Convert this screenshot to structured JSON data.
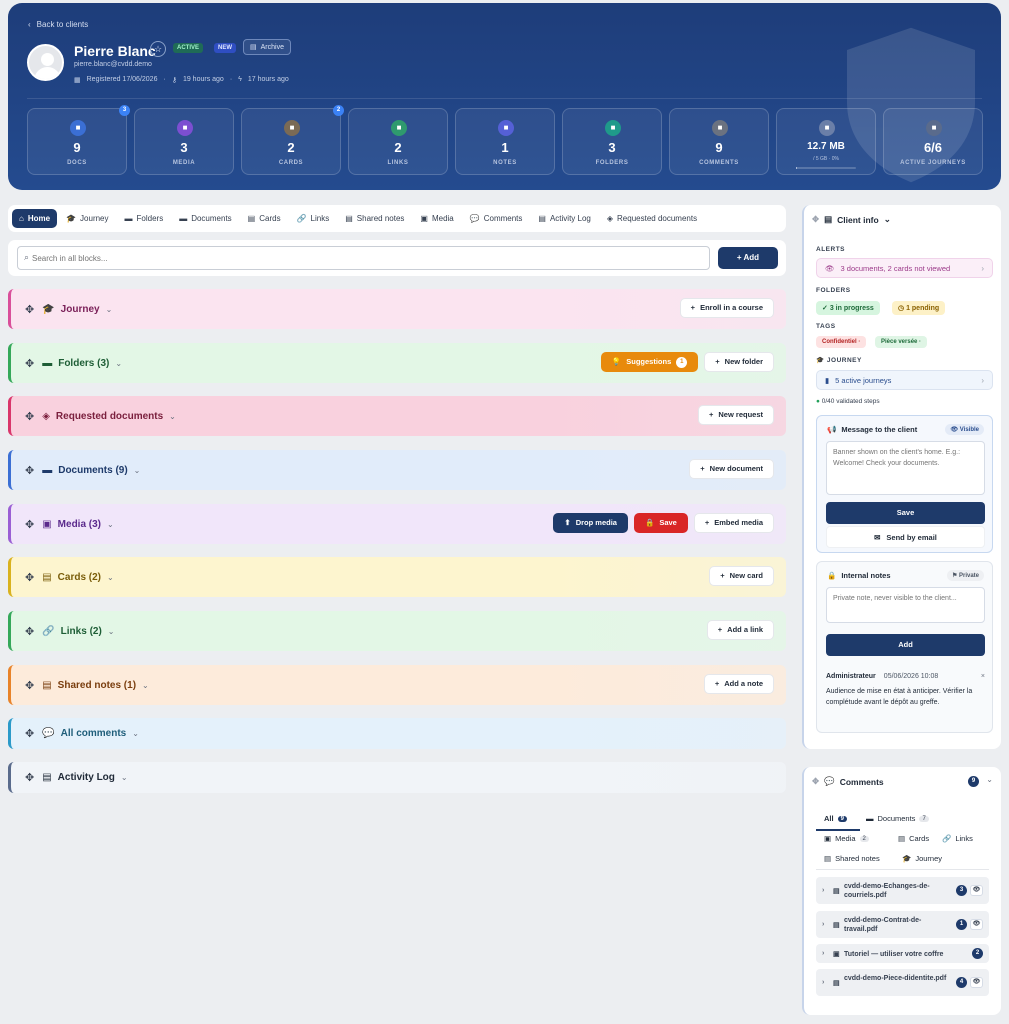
{
  "header": {
    "back_label": "Back to clients",
    "name": "Pierre Blanc",
    "badge_active": "ACTIVE",
    "badge_new": "NEW",
    "archive_label": "Archive",
    "email": "pierre.blanc@cvdd.demo",
    "registered": "Registered 17/06/2026",
    "last_login": "19 hours ago",
    "last_activity": "17 hours ago"
  },
  "stats": [
    {
      "value": "9",
      "label": "DOCS",
      "badge": "3",
      "color": "#3b6fd4",
      "icon": "doc-icon"
    },
    {
      "value": "3",
      "label": "MEDIA",
      "badge": "",
      "color": "#7c4fd1",
      "icon": "media-icon"
    },
    {
      "value": "2",
      "label": "CARDS",
      "badge": "2",
      "color": "#7a6a55",
      "icon": "card-icon"
    },
    {
      "value": "2",
      "label": "LINKS",
      "badge": "",
      "color": "#2f9a6e",
      "icon": "link-icon"
    },
    {
      "value": "1",
      "label": "NOTES",
      "badge": "",
      "color": "#5560d6",
      "icon": "note-icon"
    },
    {
      "value": "3",
      "label": "FOLDERS",
      "badge": "",
      "color": "#1f9a8a",
      "icon": "folder-icon"
    },
    {
      "value": "9",
      "label": "COMMENTS",
      "badge": "",
      "color": "#6b7280",
      "icon": "comment-icon"
    },
    {
      "value": "12.7 MB",
      "label": "",
      "sub": "/ 5 GB · 0%",
      "progress": 0.02,
      "color": "#6b7fa8",
      "icon": "cloud-icon"
    },
    {
      "value": "6/6",
      "label": "ACTIVE JOURNEYS",
      "badge": "",
      "color": "#5a6b8c",
      "icon": "graduation-icon"
    }
  ],
  "tabs": [
    "Home",
    "Journey",
    "Folders",
    "Documents",
    "Cards",
    "Links",
    "Shared notes",
    "Media",
    "Comments",
    "Activity Log",
    "Requested documents"
  ],
  "search": {
    "placeholder": "Search in all blocks...",
    "add_label": "Add"
  },
  "blocks": [
    {
      "title": "Journey",
      "actions": [
        "Enroll in a course"
      ]
    },
    {
      "title": "Folders (3)",
      "suggestions": "Suggestions",
      "suggestions_count": "1",
      "actions": [
        "New folder"
      ]
    },
    {
      "title": "Requested documents",
      "actions": [
        "New request"
      ]
    },
    {
      "title": "Documents (9)",
      "actions": [
        "New document"
      ]
    },
    {
      "title": "Media (3)",
      "drop": "Drop media",
      "save": "Save",
      "actions": [
        "Embed media"
      ]
    },
    {
      "title": "Cards (2)",
      "actions": [
        "New card"
      ]
    },
    {
      "title": "Links (2)",
      "actions": [
        "Add a link"
      ]
    },
    {
      "title": "Shared notes (1)",
      "actions": [
        "Add a note"
      ]
    },
    {
      "title": "All comments",
      "actions": []
    },
    {
      "title": "Activity Log",
      "actions": []
    }
  ],
  "client_info": {
    "title": "Client info",
    "alerts_label": "ALERTS",
    "alert_text": "3 documents, 2 cards not viewed",
    "folders_label": "FOLDERS",
    "in_progress": "3 in progress",
    "pending": "1 pending",
    "tags_label": "TAGS",
    "tag1": "Confidentiel",
    "tag2": "Pièce versée",
    "journey_label": "JOURNEY",
    "journeys": "5 active journeys",
    "validated": "0/40 validated steps"
  },
  "message": {
    "title": "Message to the client",
    "visible": "Visible",
    "placeholder": "Banner shown on the client's home. E.g.: Welcome! Check your documents.",
    "save": "Save",
    "send": "Send by email"
  },
  "notes": {
    "title": "Internal notes",
    "private": "Private",
    "placeholder": "Private note, never visible to the client...",
    "add": "Add",
    "author": "Administrateur",
    "date": "05/06/2026 10:08",
    "text": "Audience de mise en état à anticiper. Vérifier la complétude avant le dépôt au greffe."
  },
  "comments": {
    "title": "Comments",
    "count": "9",
    "tabs": [
      {
        "label": "All",
        "count": "9"
      },
      {
        "label": "Documents",
        "count": "7"
      },
      {
        "label": "Media",
        "count": "2"
      },
      {
        "label": "Cards",
        "count": ""
      },
      {
        "label": "Links",
        "count": ""
      },
      {
        "label": "Shared notes",
        "count": ""
      },
      {
        "label": "Journey",
        "count": ""
      }
    ],
    "items": [
      {
        "name": "cvdd-demo-Echanges-de-courriels.pdf",
        "count": "3"
      },
      {
        "name": "cvdd-demo-Contrat-de-travail.pdf",
        "count": "1"
      },
      {
        "name": "Tutoriel — utiliser votre coffre",
        "count": "2"
      },
      {
        "name": "cvdd-demo-Piece-didentite.pdf",
        "count": "4"
      }
    ]
  },
  "colors": {
    "journey": "#fbe4f0",
    "folders": "#e3f7e6",
    "requested": "#f9d1de",
    "documents": "#e1ecfa",
    "media": "#f1e6fa",
    "cards": "#fdf5cf",
    "links": "#e3f7e6",
    "shared": "#fdebdb",
    "comments": "#e4f1fb",
    "activity": "#f1f4f8"
  }
}
